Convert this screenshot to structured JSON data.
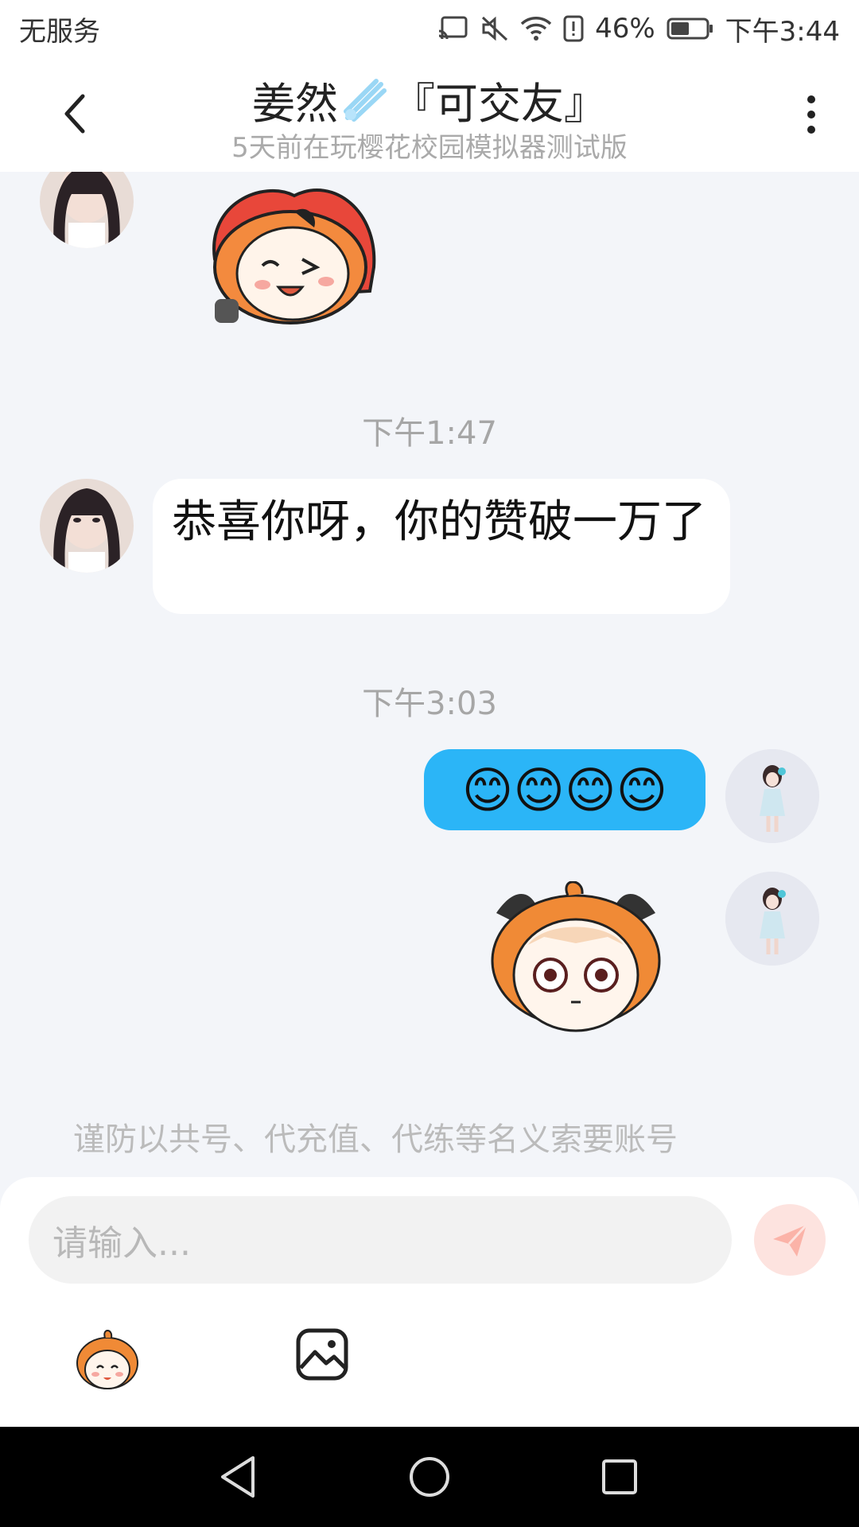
{
  "status_bar": {
    "carrier": "无服务",
    "battery": "46%",
    "time": "下午3:44"
  },
  "header": {
    "title_name": "姜然",
    "title_tag": "『可交友』",
    "subtitle": "5天前在玩樱花校园模拟器测试版"
  },
  "chat": {
    "time_1": "下午1:47",
    "message_1": "恭喜你呀，你的赞破一万了",
    "time_2": "下午3:03",
    "message_2": "😊😊😊😊",
    "notice": "谨防以共号、代充值、代练等名义索要账号"
  },
  "input": {
    "placeholder": "请输入..."
  },
  "colors": {
    "bubble_self": "#2bb5f7",
    "background": "#f3f5f9",
    "send_button": "#fde3df"
  }
}
